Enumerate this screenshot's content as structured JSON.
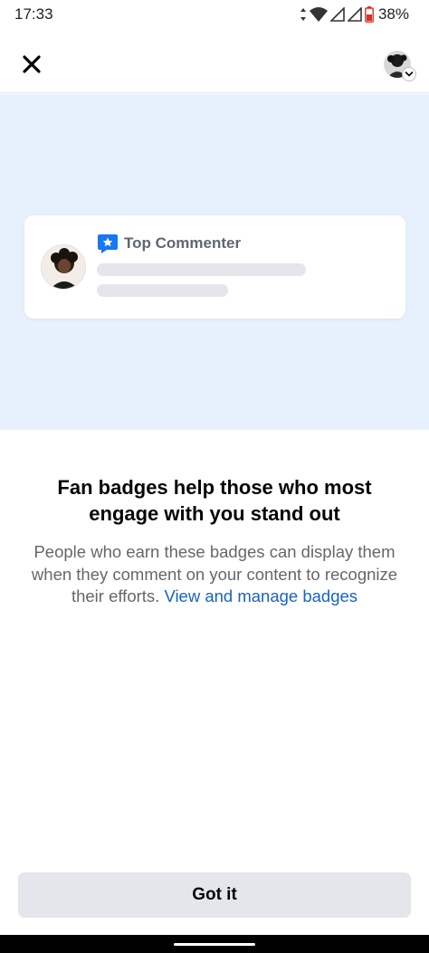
{
  "status_bar": {
    "time": "17:33",
    "battery": "38%",
    "icons": [
      "data-arrows-icon",
      "wifi-icon",
      "signal-icon",
      "signal-icon",
      "battery-icon"
    ]
  },
  "top_nav": {
    "close_icon": "close-icon",
    "profile_icon": "profile-avatar-icon",
    "chevron_icon": "chevron-down-icon"
  },
  "illustration": {
    "badge_label": "Top Commenter",
    "badge_icon": "star-badge-icon",
    "badge_color": "#1877f2",
    "background_color": "#e7f1fd"
  },
  "content": {
    "heading": "Fan badges help those who most engage with you stand out",
    "body": "People who earn these badges can display them when they comment on your content to recognize their efforts.",
    "link": "View and manage badges"
  },
  "actions": {
    "got_it": "Got it"
  },
  "colors": {
    "link": "#1663c6",
    "button_bg": "#e4e6eb"
  }
}
